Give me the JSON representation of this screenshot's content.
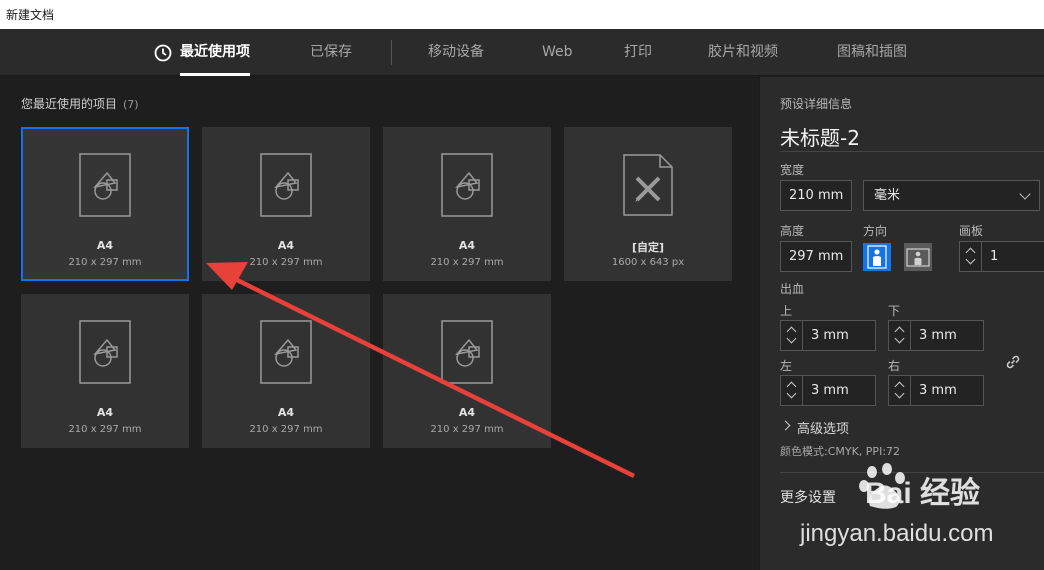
{
  "window": {
    "title": "新建文档"
  },
  "tabs": [
    {
      "label": "最近使用项",
      "active": true
    },
    {
      "label": "已保存"
    },
    {
      "label": "移动设备"
    },
    {
      "label": "Web"
    },
    {
      "label": "打印"
    },
    {
      "label": "胶片和视频"
    },
    {
      "label": "图稿和插图"
    }
  ],
  "recent": {
    "title": "您最近使用的项目",
    "count": "(7)",
    "items": [
      {
        "name": "A4",
        "size": "210 x 297 mm",
        "icon": "document-shapes-icon",
        "selected": true
      },
      {
        "name": "A4",
        "size": "210 x 297 mm",
        "icon": "document-shapes-icon"
      },
      {
        "name": "A4",
        "size": "210 x 297 mm",
        "icon": "document-shapes-icon"
      },
      {
        "name": "[自定]",
        "size": "1600 x 643 px",
        "icon": "document-ruler-pencil-icon"
      },
      {
        "name": "A4",
        "size": "210 x 297 mm",
        "icon": "document-shapes-icon"
      },
      {
        "name": "A4",
        "size": "210 x 297 mm",
        "icon": "document-shapes-icon"
      },
      {
        "name": "A4",
        "size": "210 x 297 mm",
        "icon": "document-shapes-icon"
      }
    ]
  },
  "details": {
    "header": "预设详细信息",
    "doc_name": "未标题-2",
    "width_label": "宽度",
    "width_value": "210 mm",
    "unit_value": "毫米",
    "height_label": "高度",
    "height_value": "297 mm",
    "orientation_label": "方向",
    "artboard_label": "画板",
    "artboard_value": "1",
    "bleed_label": "出血",
    "bleed_top_label": "上",
    "bleed_top": "3 mm",
    "bleed_bottom_label": "下",
    "bleed_bottom": "3 mm",
    "bleed_left_label": "左",
    "bleed_left": "3 mm",
    "bleed_right_label": "右",
    "bleed_right": "3 mm",
    "advanced_label": "高级选项",
    "color_mode": "颜色模式:CMYK, PPI:72",
    "more_settings": "更多设置"
  },
  "watermark": {
    "line1": "Bai 经验",
    "line2": "jingyan.baidu.com"
  },
  "colors": {
    "accent": "#1473e6",
    "annotation_arrow": "#e8413a"
  }
}
